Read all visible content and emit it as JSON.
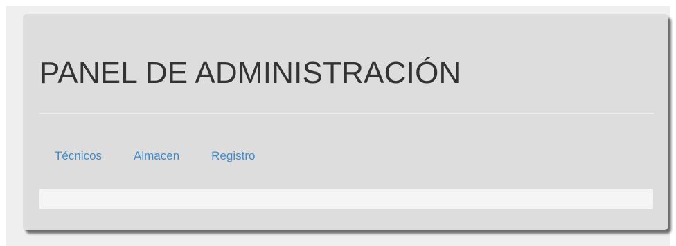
{
  "header": {
    "title": "PANEL DE ADMINISTRACIÓN"
  },
  "nav": {
    "items": [
      {
        "label": "Técnicos"
      },
      {
        "label": "Almacen"
      },
      {
        "label": "Registro"
      }
    ]
  },
  "colors": {
    "panel_background": "#dddddd",
    "link": "#428bca",
    "title_text": "#333333",
    "well_background": "#f5f5f5"
  }
}
